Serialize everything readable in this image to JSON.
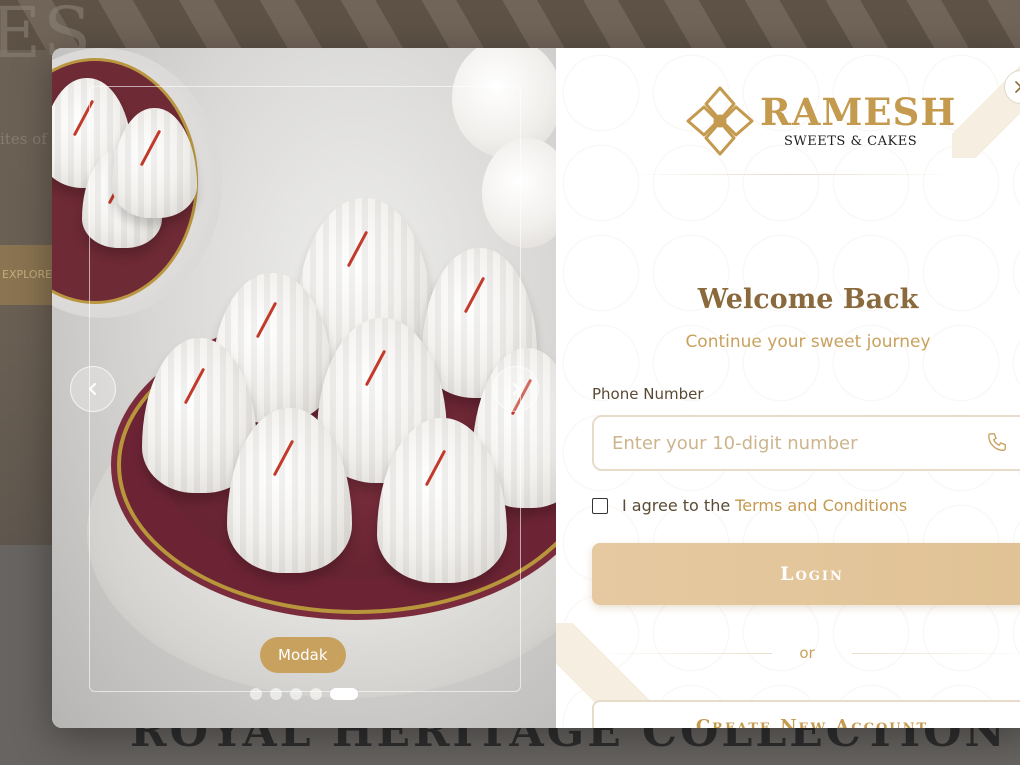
{
  "background": {
    "big_letters": "ES",
    "tagline": "ites of",
    "cta": "EXPLORE",
    "heading": "ROYAL HERITAGE COLLECTION"
  },
  "carousel": {
    "slide_label": "Modak",
    "slide_count": 5,
    "active_slide": 5
  },
  "login": {
    "brand_name": "RAMESH",
    "brand_subtitle": "SWEETS & CAKES",
    "welcome": "Welcome Back",
    "tagline": "Continue your sweet journey",
    "phone_label": "Phone Number",
    "phone_placeholder": "Enter your 10-digit number",
    "phone_value": "",
    "agree_text": "I agree to the",
    "terms_link": "Terms and Conditions",
    "terms_checked": false,
    "login_button": "Login",
    "or_text": "or",
    "create_button": "Create New Account"
  },
  "colors": {
    "gold": "#c49a4f",
    "brown": "#8a6a3d",
    "button_bg": "#e2c498"
  },
  "icons": {
    "close": "close-icon",
    "prev": "chevron-left-icon",
    "next": "chevron-right-icon",
    "phone": "phone-icon"
  }
}
